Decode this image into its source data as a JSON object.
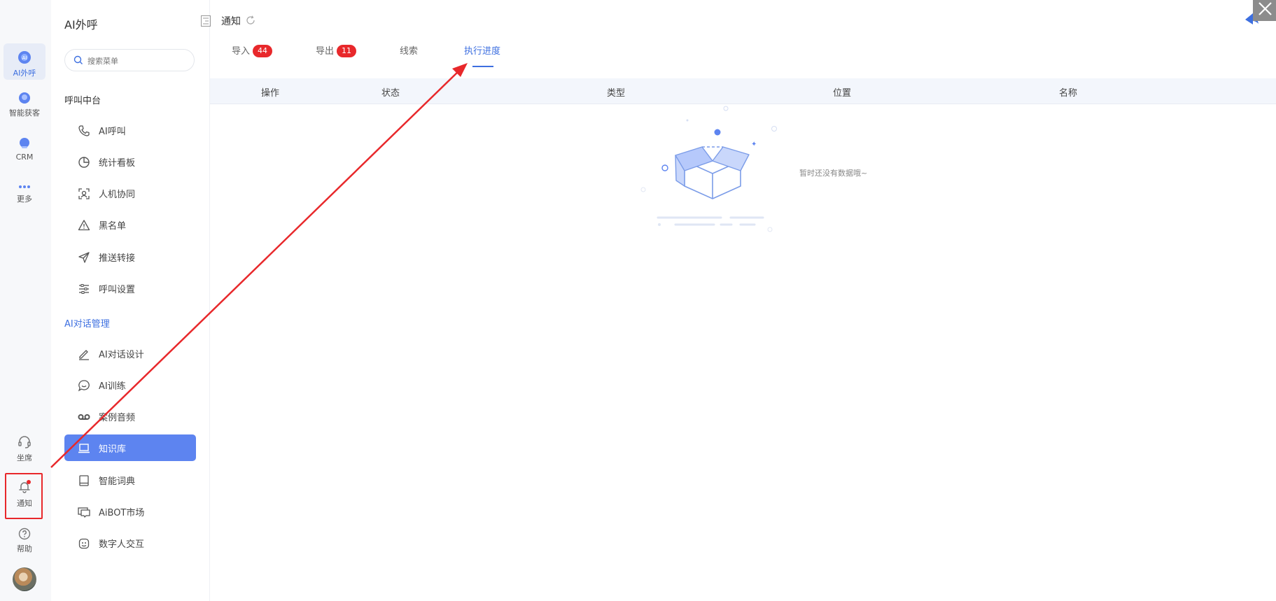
{
  "rail": {
    "items": [
      {
        "label": "AI外呼",
        "icon": "ai-call-icon"
      },
      {
        "label": "智能获客",
        "icon": "customer-acquisition-icon"
      },
      {
        "label": "CRM",
        "icon": "crm-icon"
      },
      {
        "label": "更多",
        "icon": "more-icon"
      }
    ],
    "bottom": [
      {
        "label": "坐席",
        "icon": "headset-icon"
      },
      {
        "label": "通知",
        "icon": "bell-icon"
      },
      {
        "label": "帮助",
        "icon": "help-icon"
      }
    ]
  },
  "sidebar": {
    "title": "AI外呼",
    "search_placeholder": "搜索菜单",
    "groups": [
      {
        "title": "呼叫中台",
        "items": [
          {
            "label": "AI呼叫",
            "icon": "phone-icon"
          },
          {
            "label": "统计看板",
            "icon": "pie-chart-icon"
          },
          {
            "label": "人机协同",
            "icon": "face-scan-icon"
          },
          {
            "label": "黑名单",
            "icon": "warning-icon"
          },
          {
            "label": "推送转接",
            "icon": "send-icon"
          },
          {
            "label": "呼叫设置",
            "icon": "sliders-icon"
          }
        ]
      },
      {
        "title": "AI对话管理",
        "items": [
          {
            "label": "AI对话设计",
            "icon": "pen-icon"
          },
          {
            "label": "AI训练",
            "icon": "chat-bubble-icon"
          },
          {
            "label": "案例音频",
            "icon": "voicemail-icon"
          },
          {
            "label": "知识库",
            "icon": "laptop-icon"
          },
          {
            "label": "智能词典",
            "icon": "book-icon"
          },
          {
            "label": "AiBOT市场",
            "icon": "screen-chat-icon"
          },
          {
            "label": "数字人交互",
            "icon": "robot-face-icon"
          }
        ]
      }
    ]
  },
  "main": {
    "title": "通知",
    "tabs": [
      {
        "label": "导入",
        "badge": "44"
      },
      {
        "label": "导出",
        "badge": "11"
      },
      {
        "label": "线索",
        "badge": ""
      },
      {
        "label": "执行进度",
        "badge": ""
      }
    ],
    "columns": [
      "操作",
      "状态",
      "类型",
      "位置",
      "名称"
    ],
    "empty_text": "暂时还没有数据哦~"
  },
  "colors": {
    "accent": "#3d6fe0",
    "badge": "#e8282b",
    "selected_bg": "#5d84f0",
    "annotation": "#e8282b"
  }
}
